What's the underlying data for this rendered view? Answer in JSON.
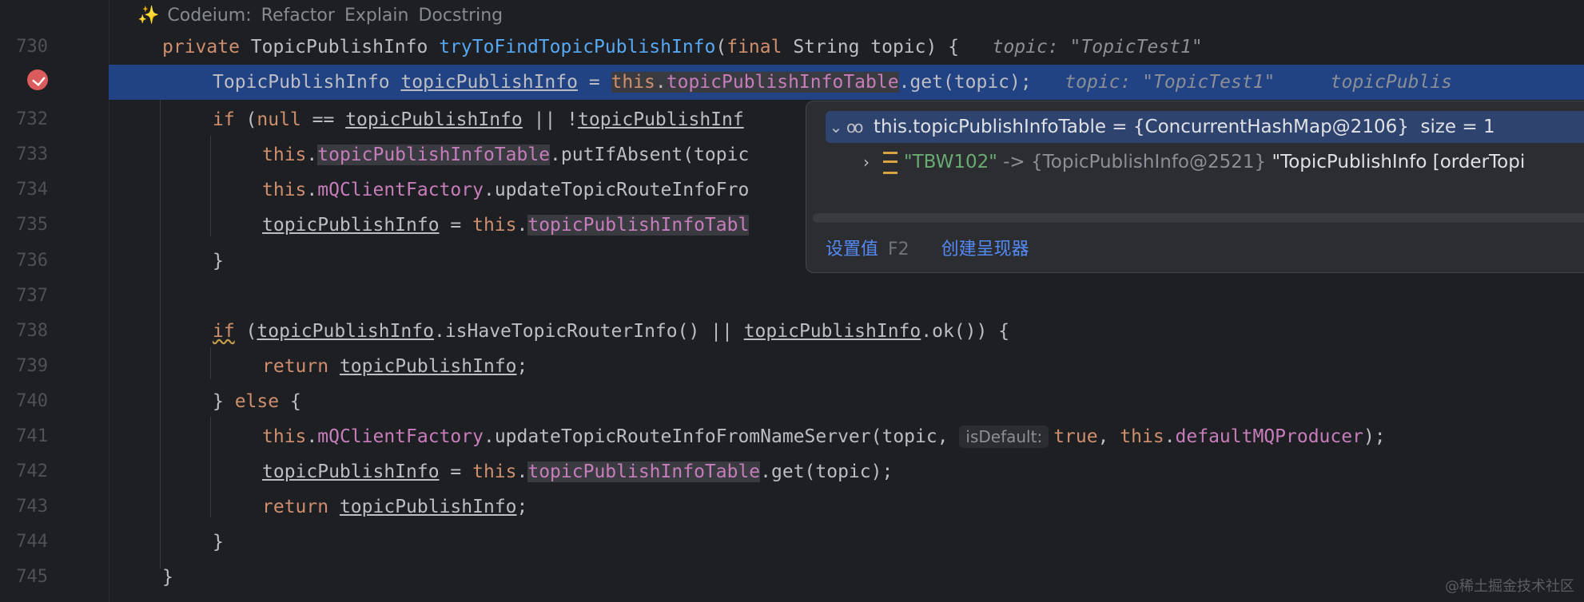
{
  "hint_bar": {
    "spark": "✨",
    "label": "Codeium:",
    "actions": [
      "Refactor",
      "Explain",
      "Docstring"
    ]
  },
  "line_numbers": [
    "730",
    "",
    "732",
    "733",
    "734",
    "735",
    "736",
    "737",
    "738",
    "739",
    "740",
    "741",
    "742",
    "743",
    "744",
    "745"
  ],
  "code": {
    "l730": {
      "kw": "private",
      "type": " TopicPublishInfo ",
      "fn": "tryToFindTopicPublishInfo",
      "p1": "(",
      "kw2": "final",
      "rest": " String topic) {",
      "hint": "topic: \"TopicTest1\""
    },
    "l731": {
      "type": "TopicPublishInfo ",
      "var": "topicPublishInfo",
      "eq": " = ",
      "kw": "this",
      "dot": ".",
      "fld": "topicPublishInfoTable",
      "rest": ".get(topic);",
      "hint1": "topic: \"TopicTest1\"",
      "hint2": "topicPublis"
    },
    "l732": {
      "kw": "if",
      "p": " (",
      "kw2": "null",
      "eq": " == ",
      "var": "topicPublishInfo",
      "or": " || !",
      "var2": "topicPublishInf"
    },
    "l733": {
      "kw": "this",
      "dot": ".",
      "fld": "topicPublishInfoTable",
      "rest": ".putIfAbsent(topic"
    },
    "l734": {
      "kw": "this",
      "dot": ".",
      "fld": "mQClientFactory",
      "rest": ".updateTopicRouteInfoFro"
    },
    "l735": {
      "var": "topicPublishInfo",
      "eq": " = ",
      "kw": "this",
      "dot": ".",
      "fld": "topicPublishInfoTabl"
    },
    "l736": {
      "text": "}"
    },
    "l738": {
      "kw": "if",
      "p": " (",
      "var": "topicPublishInfo",
      "m1": ".isHaveTopicRouterInfo() || ",
      "var2": "topicPublishInfo",
      "m2": ".ok()) {"
    },
    "l739": {
      "kw": "return",
      "sp": " ",
      "var": "topicPublishInfo",
      "end": ";"
    },
    "l740": {
      "b": "} ",
      "kw": "else",
      "rest": " {"
    },
    "l741": {
      "kw": "this",
      "dot": ".",
      "fld": "mQClientFactory",
      "rest": ".updateTopicRouteInfoFromNameServer(topic, ",
      "chip": "isDefault:",
      "kw2": "true",
      "comma": ", ",
      "kw3": "this",
      "dot2": ".",
      "fld2": "defaultMQProducer",
      "end": ");"
    },
    "l742": {
      "var": "topicPublishInfo",
      "eq": " = ",
      "kw": "this",
      "dot": ".",
      "fld": "topicPublishInfoTable",
      "rest": ".get(topic);"
    },
    "l743": {
      "kw": "return",
      "sp": " ",
      "var": "topicPublishInfo",
      "end": ";"
    },
    "l744": {
      "text": "}"
    },
    "l745": {
      "text": "}"
    }
  },
  "popup": {
    "row1": {
      "expr": "this.topicPublishInfoTable = {ConcurrentHashMap@2106}",
      "size": "size = 1"
    },
    "row2": {
      "key": "\"TBW102\"",
      "arrow": " -> {TopicPublishInfo@2521} ",
      "value": "\"TopicPublishInfo [orderTopi"
    },
    "footer": {
      "set_value": "设置值",
      "set_value_key": "F2",
      "create_renderer": "创建呈现器"
    }
  },
  "watermark": "@稀土掘金技术社区",
  "colors": {
    "keyword": "#cf8e6d",
    "field": "#c77dbb",
    "method": "#56a8f5",
    "selection": "#214283",
    "breakpoint": "#db5c5c"
  }
}
